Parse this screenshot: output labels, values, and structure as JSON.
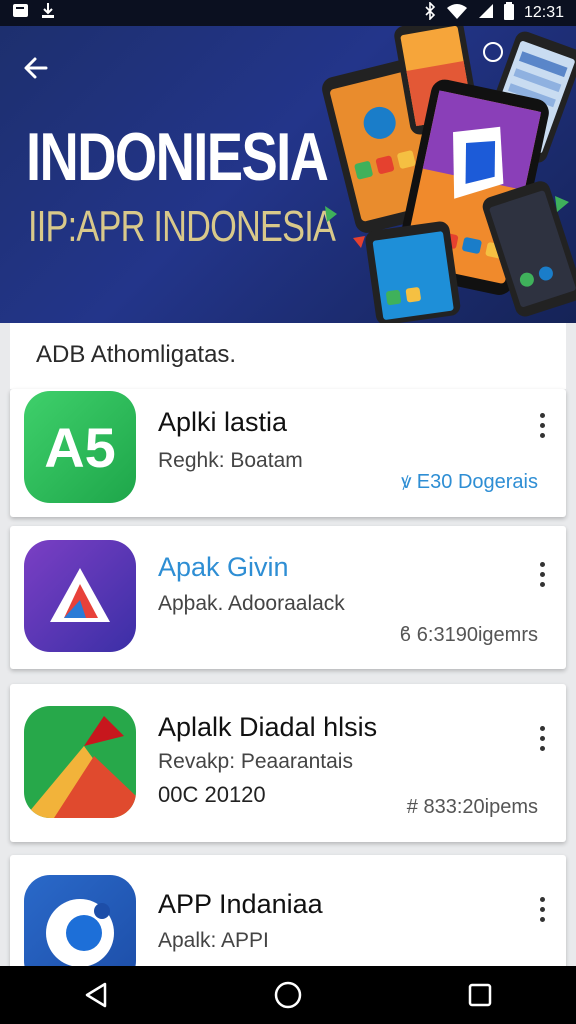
{
  "status_bar": {
    "time": "12:31"
  },
  "hero": {
    "title": "INDONIESIA",
    "subtitle": "IIP:APR INDONESIA"
  },
  "section": {
    "title": "ADB Athomligatas."
  },
  "apps": [
    {
      "name": "Aplki lastia",
      "sub": "Reghk: Boatam",
      "extra": "",
      "size": "ꝟ E30 Dogerais"
    },
    {
      "name": "Apak Givin",
      "sub": "Apþak. Adooraalack",
      "extra": "",
      "size": "ϐ 6:3190igemrs"
    },
    {
      "name": "Aplalk Diadal hlsis",
      "sub": "Revakp: Peaarantais",
      "extra": "00C 20120",
      "size": "# 833:20ipems"
    },
    {
      "name": "APP Indaniaa",
      "sub": "Apalk: APPI",
      "extra": "",
      "size": ""
    }
  ],
  "colors": {
    "hero_bg": "#1d2f6e",
    "accent_blue": "#2e8ed4",
    "subtitle_gold": "#d9c98a"
  }
}
